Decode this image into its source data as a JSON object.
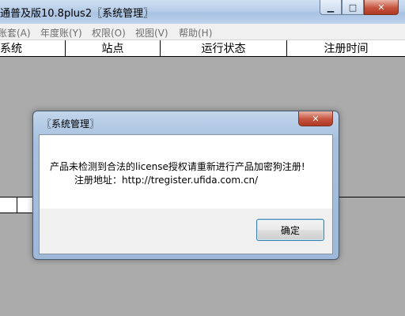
{
  "window": {
    "title": "通普及版10.8plus2〖系统管理〗",
    "buttons": {
      "minimize": "▁",
      "maximize": "□",
      "close": "✕"
    }
  },
  "menu": [
    "账套(A)",
    "年度账(Y)",
    "权限(O)",
    "视图(V)",
    "帮助(H)"
  ],
  "columns": [
    "系统",
    "站点",
    "运行状态",
    "注册时间"
  ],
  "dialog": {
    "title": "〖系统管理〗",
    "close": "✕",
    "message_line1": "产品未检测到合法的license授权请重新进行产品加密狗注册!",
    "message_line2": "注册地址：http://tregister.ufida.com.cn/",
    "ok_label": "确定"
  },
  "colors": {
    "background": "#ababab",
    "dialog_frame": "#a8c1de",
    "close_red": "#c6533e"
  }
}
